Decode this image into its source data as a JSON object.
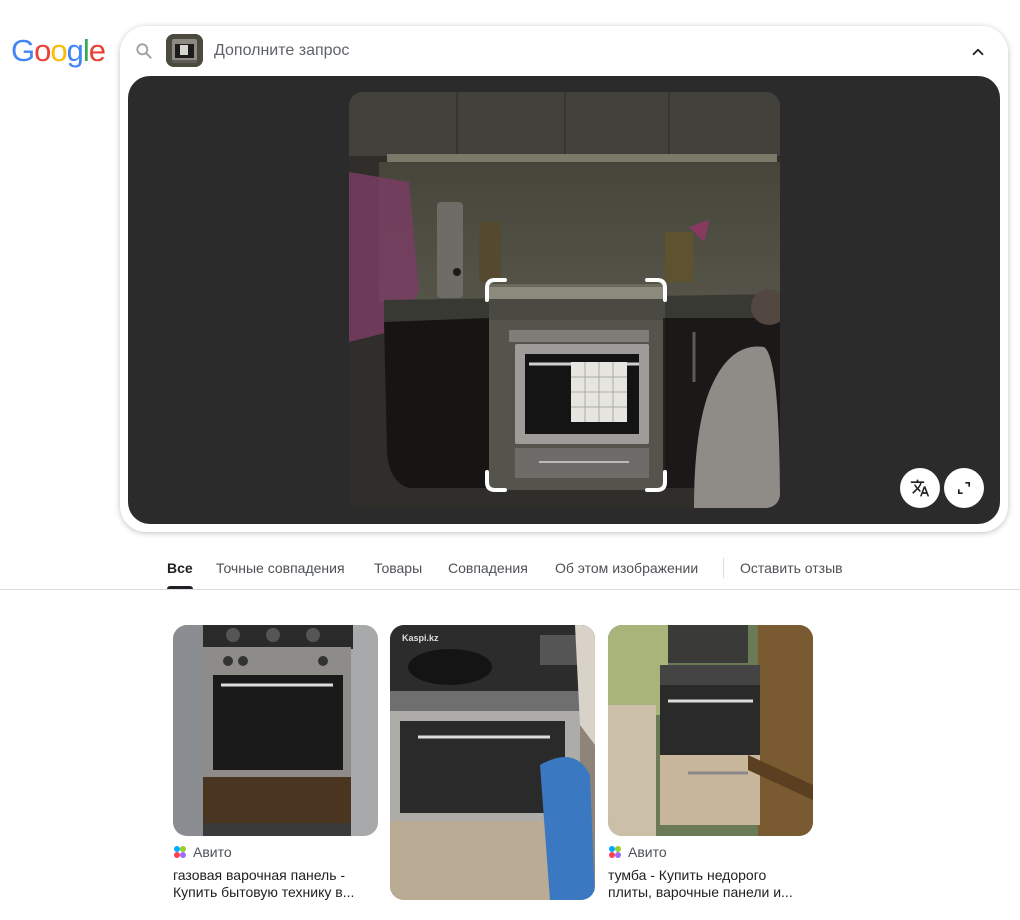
{
  "logo": {
    "letters": [
      "G",
      "o",
      "o",
      "g",
      "l",
      "e"
    ],
    "colors": [
      "#4285F4",
      "#EA4335",
      "#FBBC05",
      "#4285F4",
      "#34A853",
      "#EA4335"
    ]
  },
  "search": {
    "placeholder": "Дополните запрос",
    "icons": {
      "search": "search-icon",
      "collapse": "chevron-up-icon",
      "translate": "translate-icon",
      "expand": "expand-icon"
    }
  },
  "tabs": [
    {
      "label": "Все",
      "active": true
    },
    {
      "label": "Точные совпадения",
      "active": false
    },
    {
      "label": "Товары",
      "active": false
    },
    {
      "label": "Совпадения",
      "active": false
    },
    {
      "label": "Об этом изображении",
      "active": false
    },
    {
      "label": "Оставить отзыв",
      "active": false
    }
  ],
  "results": [
    {
      "source": "Авито",
      "title": "газовая варочная панель - Купить бытовую технику в..."
    },
    {
      "source": "",
      "title": "",
      "watermark": "Kaspi.kz"
    },
    {
      "source": "Авито",
      "title": "тумба - Купить недорого плиты, варочные панели и..."
    }
  ],
  "colors": {
    "text": "#202124",
    "secondary": "#4d5156",
    "divider": "#dadce0",
    "viewer_bg": "#2b2b2b"
  }
}
